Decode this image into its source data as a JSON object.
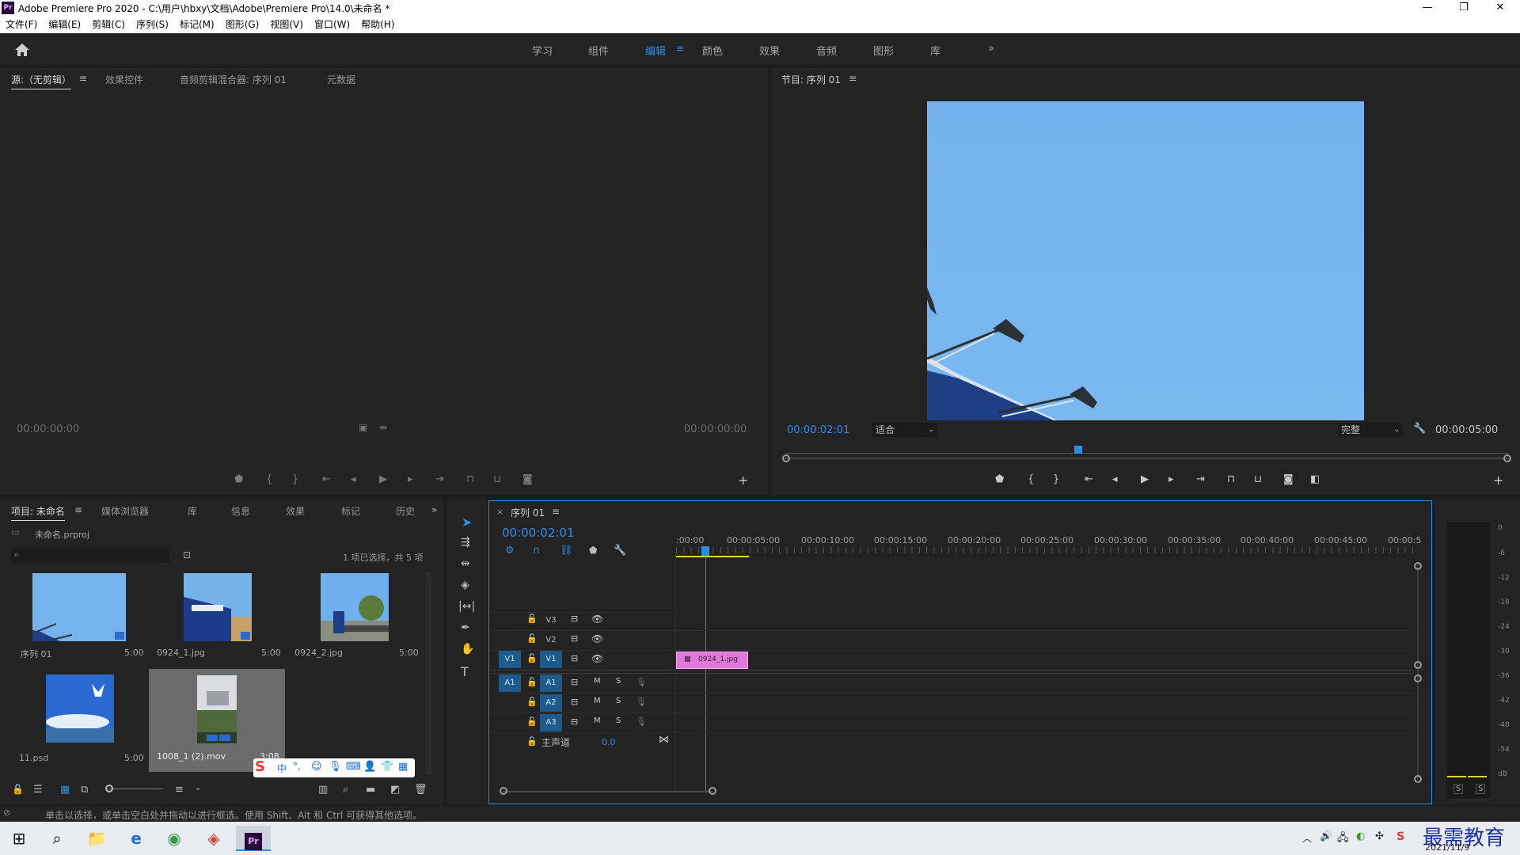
{
  "window": {
    "app_icon": "Pr",
    "title": "Adobe Premiere Pro 2020 - C:\\用户\\hbxy\\文档\\Adobe\\Premiere Pro\\14.0\\未命名 *",
    "minimize": "—",
    "restore": "❐",
    "close": "✕"
  },
  "menu": [
    "文件(F)",
    "编辑(E)",
    "剪辑(C)",
    "序列(S)",
    "标记(M)",
    "图形(G)",
    "视图(V)",
    "窗口(W)",
    "帮助(H)"
  ],
  "workspaces": {
    "items": [
      "学习",
      "组件",
      "编辑",
      "颜色",
      "效果",
      "音频",
      "图形",
      "库"
    ],
    "active": "编辑",
    "more": "»"
  },
  "source_panel": {
    "tabs": [
      "源:（无剪辑）",
      "效果控件",
      "音频剪辑混合器: 序列 01",
      "元数据"
    ],
    "timecode_left": "00:00:00:00",
    "timecode_right": "00:00:00:00"
  },
  "program_panel": {
    "tab": "节目: 序列 01",
    "timecode_current": "00:00:02:01",
    "fit": "适合",
    "quality": "完整",
    "timecode_duration": "00:00:05:00"
  },
  "project_panel": {
    "tabs": [
      "项目: 未命名",
      "媒体浏览器",
      "库",
      "信息",
      "效果",
      "标记",
      "历史"
    ],
    "project_file": "未命名.prproj",
    "selection_info": "1 项已选择，共 5 项",
    "items": [
      {
        "name": "序列 01",
        "duration": "5:00"
      },
      {
        "name": "0924_1.jpg",
        "duration": "5:00"
      },
      {
        "name": "0924_2.jpg",
        "duration": "5:00"
      },
      {
        "name": "11.psd",
        "duration": "5:00"
      },
      {
        "name": "1008_1 (2).mov",
        "duration": "3:08"
      }
    ]
  },
  "ime_toolbar": {
    "logo": "S",
    "mode": "中"
  },
  "timeline": {
    "tab": "序列 01",
    "timecode": "00:00:02:01",
    "ruler": [
      ":00:00",
      "00:00:05:00",
      "00:00:10:00",
      "00:00:15:00",
      "00:00:20:00",
      "00:00:25:00",
      "00:00:30:00",
      "00:00:35:00",
      "00:00:40:00",
      "00:00:45:00",
      "00:00:5"
    ],
    "video_tracks": [
      "V3",
      "V2",
      "V1"
    ],
    "audio_tracks": [
      "A1",
      "A2",
      "A3"
    ],
    "source_v": "V1",
    "source_a": "A1",
    "m_label": "M",
    "s_label": "S",
    "master_label": "主声道",
    "master_value": "0.0",
    "clip_name": "0924_1.jpg"
  },
  "audio_meter": {
    "scale": [
      "0",
      "-6",
      "-12",
      "-18",
      "-24",
      "-30",
      "-36",
      "-42",
      "-48",
      "-54",
      "dB"
    ],
    "solo_left": "S",
    "solo_right": "S"
  },
  "status": "单击以选择，或单击空白处并拖动以进行框选。使用 Shift、Alt 和 Ctrl 可获得其他选项。",
  "taskbar": {
    "date": "2021/11/9",
    "watermark": "最需教育"
  },
  "colors": {
    "accent": "#2d8ceb",
    "clip": "#e07ad8",
    "panel": "#232323",
    "sky": "#72b3ef"
  }
}
